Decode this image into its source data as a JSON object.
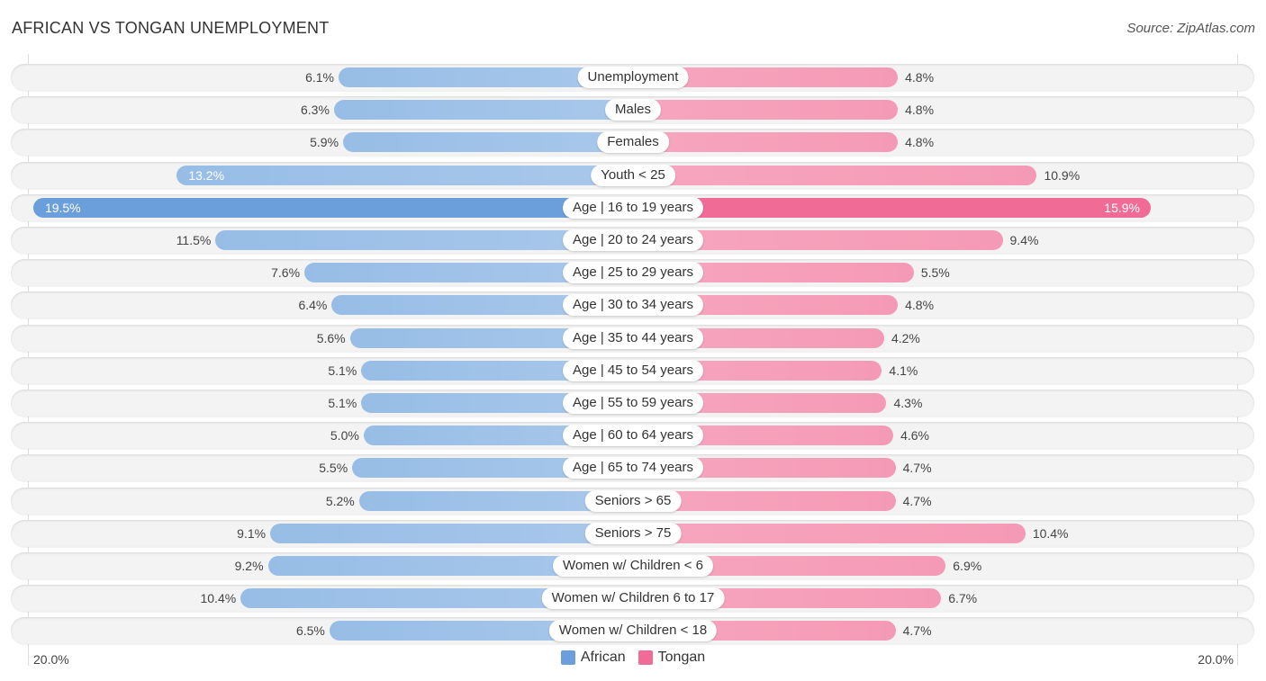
{
  "header": {
    "title": "AFRICAN VS TONGAN UNEMPLOYMENT",
    "source": "Source: ZipAtlas.com"
  },
  "colors": {
    "african": "#6a9fdc",
    "tongan": "#f06b95"
  },
  "chart_data": {
    "type": "bar",
    "orientation": "horizontal-diverging",
    "title": "AFRICAN VS TONGAN UNEMPLOYMENT",
    "xlabel": "",
    "ylabel": "",
    "xlim": [
      -20.0,
      20.0
    ],
    "axis_labels": {
      "left": "20.0%",
      "right": "20.0%"
    },
    "legend": {
      "placement": "bottom-center",
      "entries": [
        "African",
        "Tongan"
      ]
    },
    "grid": false,
    "categories": [
      "Unemployment",
      "Males",
      "Females",
      "Youth < 25",
      "Age | 16 to 19 years",
      "Age | 20 to 24 years",
      "Age | 25 to 29 years",
      "Age | 30 to 34 years",
      "Age | 35 to 44 years",
      "Age | 45 to 54 years",
      "Age | 55 to 59 years",
      "Age | 60 to 64 years",
      "Age | 65 to 74 years",
      "Seniors > 65",
      "Seniors > 75",
      "Women w/ Children < 6",
      "Women w/ Children 6 to 17",
      "Women w/ Children < 18"
    ],
    "series": [
      {
        "name": "African",
        "side": "left",
        "values": [
          6.1,
          6.3,
          5.9,
          13.2,
          19.5,
          11.5,
          7.6,
          6.4,
          5.6,
          5.1,
          5.1,
          5.0,
          5.5,
          5.2,
          9.1,
          9.2,
          10.4,
          6.5
        ],
        "labels": [
          "6.1%",
          "6.3%",
          "5.9%",
          "13.2%",
          "19.5%",
          "11.5%",
          "7.6%",
          "6.4%",
          "5.6%",
          "5.1%",
          "5.1%",
          "5.0%",
          "5.5%",
          "5.2%",
          "9.1%",
          "9.2%",
          "10.4%",
          "6.5%"
        ]
      },
      {
        "name": "Tongan",
        "side": "right",
        "values": [
          4.8,
          4.8,
          4.8,
          10.9,
          15.9,
          9.4,
          5.5,
          4.8,
          4.2,
          4.1,
          4.3,
          4.6,
          4.7,
          4.7,
          10.4,
          6.9,
          6.7,
          4.7
        ],
        "labels": [
          "4.8%",
          "4.8%",
          "4.8%",
          "10.9%",
          "15.9%",
          "9.4%",
          "5.5%",
          "4.8%",
          "4.2%",
          "4.1%",
          "4.3%",
          "4.6%",
          "4.7%",
          "4.7%",
          "10.4%",
          "6.9%",
          "6.7%",
          "4.7%"
        ]
      }
    ]
  }
}
